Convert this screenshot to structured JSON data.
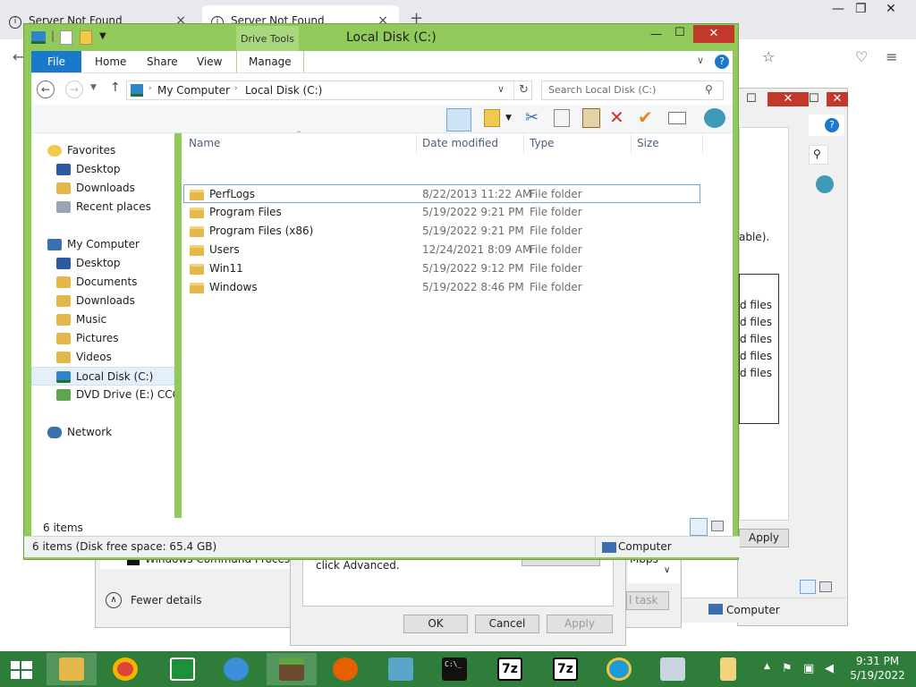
{
  "browser": {
    "tabs": [
      {
        "label": "Server Not Found"
      },
      {
        "label": "Server Not Found"
      }
    ],
    "new_tab": "+",
    "close": "×",
    "min": "—",
    "max": "❐",
    "win_close": "✕"
  },
  "bg_dialog": {
    "text_able": "able).",
    "files": [
      "d files",
      "d files",
      "d files",
      "d files",
      "d files"
    ],
    "apply": "Apply",
    "command_processor": "Windows Command Processor",
    "advanced_text": "click Advanced.",
    "ok": "OK",
    "cancel": "Cancel",
    "apply2": "Apply",
    "mbps": "Mbps",
    "task": "l task",
    "fewer_details": "Fewer details",
    "computer": "Computer"
  },
  "explorer": {
    "title": "Local Disk (C:)",
    "drive_tools": "Drive Tools",
    "tabs": {
      "file": "File",
      "home": "Home",
      "share": "Share",
      "view": "View",
      "manage": "Manage"
    },
    "breadcrumb": [
      "My Computer",
      "Local Disk (C:)"
    ],
    "search_placeholder": "Search Local Disk (C:)",
    "columns": {
      "name": "Name",
      "date": "Date modified",
      "type": "Type",
      "size": "Size"
    },
    "nav": {
      "favorites": "Favorites",
      "fav_items": [
        "Desktop",
        "Downloads",
        "Recent places"
      ],
      "computer": "My Computer",
      "comp_items": [
        "Desktop",
        "Documents",
        "Downloads",
        "Music",
        "Pictures",
        "Videos",
        "Local Disk (C:)",
        "DVD Drive (E:) CCCC"
      ],
      "network": "Network"
    },
    "files": [
      {
        "name": "PerfLogs",
        "date": "8/22/2013 11:22 AM",
        "type": "File folder"
      },
      {
        "name": "Program Files",
        "date": "5/19/2022 9:21 PM",
        "type": "File folder"
      },
      {
        "name": "Program Files (x86)",
        "date": "5/19/2022 9:21 PM",
        "type": "File folder"
      },
      {
        "name": "Users",
        "date": "12/24/2021 8:09 AM",
        "type": "File folder"
      },
      {
        "name": "Win11",
        "date": "5/19/2022 9:12 PM",
        "type": "File folder"
      },
      {
        "name": "Windows",
        "date": "5/19/2022 8:46 PM",
        "type": "File folder"
      }
    ],
    "item_count": "6 items",
    "status": "6 items (Disk free space: 65.4 GB)",
    "status_computer": "Computer"
  },
  "taskbar": {
    "time": "9:31 PM",
    "date": "5/19/2022",
    "sevenzip": "7z",
    "cmd_label": "C:\\_"
  },
  "colors": {
    "accent": "#1979ca",
    "frame": "#91c95b",
    "taskbar": "#2f7d3a"
  }
}
